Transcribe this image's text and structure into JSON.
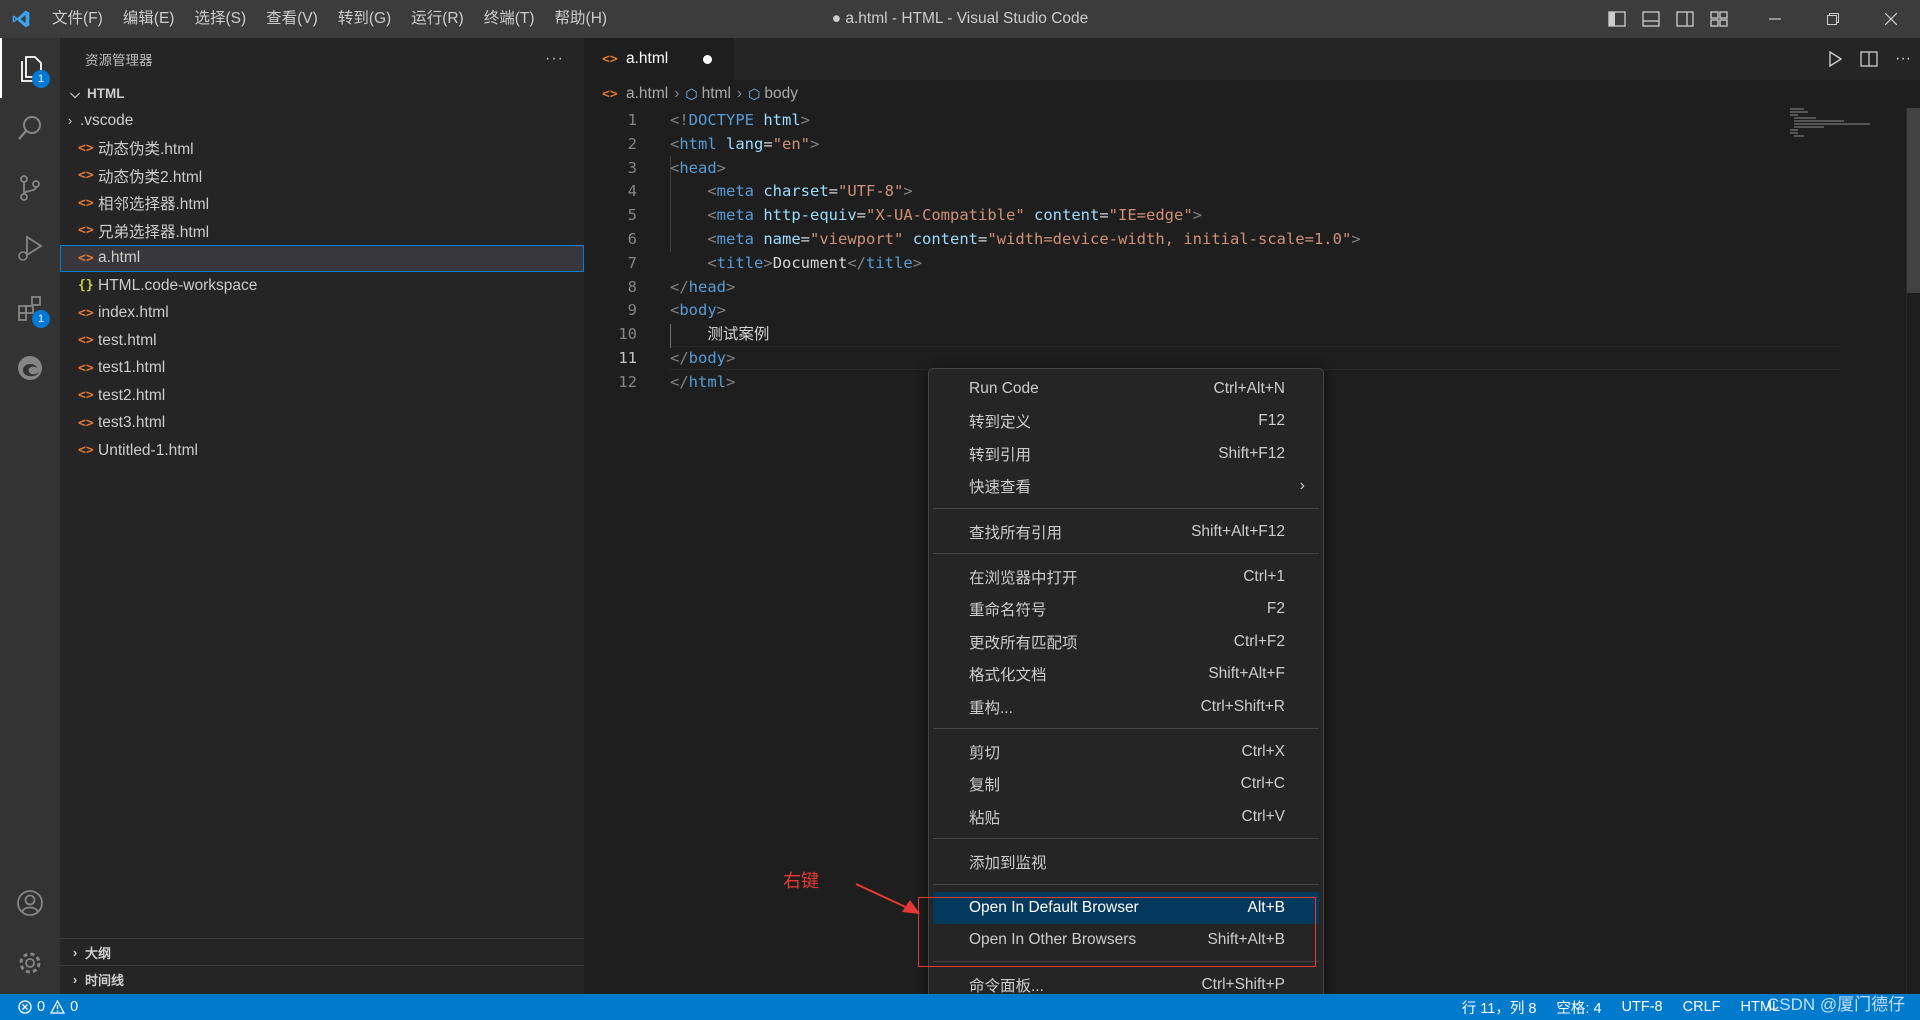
{
  "titlebar": {
    "menus": [
      "文件(F)",
      "编辑(E)",
      "选择(S)",
      "查看(V)",
      "转到(G)",
      "运行(R)",
      "终端(T)",
      "帮助(H)"
    ],
    "window_title": "● a.html - HTML - Visual Studio Code"
  },
  "activitybar": {
    "explorer_badge": "1",
    "extensions_badge": "1"
  },
  "sidebar": {
    "header": "资源管理器",
    "more": "···",
    "folder": "HTML",
    "items": [
      {
        "label": ".vscode",
        "kind": "folder"
      },
      {
        "label": "动态伪类.html",
        "kind": "html"
      },
      {
        "label": "动态伪类2.html",
        "kind": "html"
      },
      {
        "label": "相邻选择器.html",
        "kind": "html"
      },
      {
        "label": "兄弟选择器.html",
        "kind": "html"
      },
      {
        "label": "a.html",
        "kind": "html",
        "selected": true
      },
      {
        "label": "HTML.code-workspace",
        "kind": "json"
      },
      {
        "label": "index.html",
        "kind": "html"
      },
      {
        "label": "test.html",
        "kind": "html"
      },
      {
        "label": "test1.html",
        "kind": "html"
      },
      {
        "label": "test2.html",
        "kind": "html"
      },
      {
        "label": "test3.html",
        "kind": "html"
      },
      {
        "label": "Untitled-1.html",
        "kind": "html"
      }
    ],
    "outline": "大纲",
    "timeline": "时间线"
  },
  "tab": {
    "label": "a.html"
  },
  "breadcrumb": {
    "file": "a.html",
    "html": "html",
    "body": "body"
  },
  "editor": {
    "current_line": 11,
    "lines": [
      [
        {
          "t": "br",
          "v": "<!"
        },
        {
          "t": "tag",
          "v": "DOCTYPE"
        },
        {
          "t": "txt",
          "v": " "
        },
        {
          "t": "attr",
          "v": "html"
        },
        {
          "t": "br",
          "v": ">"
        }
      ],
      [
        {
          "t": "br",
          "v": "<"
        },
        {
          "t": "tag",
          "v": "html"
        },
        {
          "t": "txt",
          "v": " "
        },
        {
          "t": "attr",
          "v": "lang"
        },
        {
          "t": "txt",
          "v": "="
        },
        {
          "t": "str",
          "v": "\"en\""
        },
        {
          "t": "br",
          "v": ">"
        }
      ],
      [
        {
          "t": "br",
          "v": "<"
        },
        {
          "t": "tag",
          "v": "head"
        },
        {
          "t": "br",
          "v": ">"
        }
      ],
      [
        {
          "t": "txt",
          "v": "    "
        },
        {
          "t": "br",
          "v": "<"
        },
        {
          "t": "tag",
          "v": "meta"
        },
        {
          "t": "txt",
          "v": " "
        },
        {
          "t": "attr",
          "v": "charset"
        },
        {
          "t": "txt",
          "v": "="
        },
        {
          "t": "str",
          "v": "\"UTF-8\""
        },
        {
          "t": "br",
          "v": ">"
        }
      ],
      [
        {
          "t": "txt",
          "v": "    "
        },
        {
          "t": "br",
          "v": "<"
        },
        {
          "t": "tag",
          "v": "meta"
        },
        {
          "t": "txt",
          "v": " "
        },
        {
          "t": "attr",
          "v": "http-equiv"
        },
        {
          "t": "txt",
          "v": "="
        },
        {
          "t": "str",
          "v": "\"X-UA-Compatible\""
        },
        {
          "t": "txt",
          "v": " "
        },
        {
          "t": "attr",
          "v": "content"
        },
        {
          "t": "txt",
          "v": "="
        },
        {
          "t": "str",
          "v": "\"IE=edge\""
        },
        {
          "t": "br",
          "v": ">"
        }
      ],
      [
        {
          "t": "txt",
          "v": "    "
        },
        {
          "t": "br",
          "v": "<"
        },
        {
          "t": "tag",
          "v": "meta"
        },
        {
          "t": "txt",
          "v": " "
        },
        {
          "t": "attr",
          "v": "name"
        },
        {
          "t": "txt",
          "v": "="
        },
        {
          "t": "str",
          "v": "\"viewport\""
        },
        {
          "t": "txt",
          "v": " "
        },
        {
          "t": "attr",
          "v": "content"
        },
        {
          "t": "txt",
          "v": "="
        },
        {
          "t": "str",
          "v": "\"width=device-width, initial-scale=1.0\""
        },
        {
          "t": "br",
          "v": ">"
        }
      ],
      [
        {
          "t": "txt",
          "v": "    "
        },
        {
          "t": "br",
          "v": "<"
        },
        {
          "t": "tag",
          "v": "title"
        },
        {
          "t": "br",
          "v": ">"
        },
        {
          "t": "txt",
          "v": "Document"
        },
        {
          "t": "br",
          "v": "</"
        },
        {
          "t": "tag",
          "v": "title"
        },
        {
          "t": "br",
          "v": ">"
        }
      ],
      [
        {
          "t": "br",
          "v": "</"
        },
        {
          "t": "tag",
          "v": "head"
        },
        {
          "t": "br",
          "v": ">"
        }
      ],
      [
        {
          "t": "br",
          "v": "<"
        },
        {
          "t": "tag",
          "v": "body"
        },
        {
          "t": "br",
          "v": ">"
        }
      ],
      [
        {
          "t": "txt",
          "v": "    测试案例"
        }
      ],
      [
        {
          "t": "br",
          "v": "</"
        },
        {
          "t": "tag",
          "v": "body"
        },
        {
          "t": "br",
          "v": ">"
        }
      ],
      [
        {
          "t": "br",
          "v": "</"
        },
        {
          "t": "tag",
          "v": "html"
        },
        {
          "t": "br",
          "v": ">"
        }
      ]
    ]
  },
  "context_menu": {
    "groups": [
      [
        {
          "label": "Run Code",
          "key": "Ctrl+Alt+N"
        },
        {
          "label": "转到定义",
          "key": "F12"
        },
        {
          "label": "转到引用",
          "key": "Shift+F12"
        },
        {
          "label": "快速查看",
          "key": "",
          "submenu": true
        }
      ],
      [
        {
          "label": "查找所有引用",
          "key": "Shift+Alt+F12"
        }
      ],
      [
        {
          "label": "在浏览器中打开",
          "key": "Ctrl+1"
        },
        {
          "label": "重命名符号",
          "key": "F2"
        },
        {
          "label": "更改所有匹配项",
          "key": "Ctrl+F2"
        },
        {
          "label": "格式化文档",
          "key": "Shift+Alt+F"
        },
        {
          "label": "重构...",
          "key": "Ctrl+Shift+R"
        }
      ],
      [
        {
          "label": "剪切",
          "key": "Ctrl+X"
        },
        {
          "label": "复制",
          "key": "Ctrl+C"
        },
        {
          "label": "粘贴",
          "key": "Ctrl+V"
        }
      ],
      [
        {
          "label": "添加到监视",
          "key": ""
        }
      ],
      [
        {
          "label": "Open In Default Browser",
          "key": "Alt+B",
          "highlighted": true
        },
        {
          "label": "Open In Other Browsers",
          "key": "Shift+Alt+B"
        }
      ],
      [
        {
          "label": "命令面板...",
          "key": "Ctrl+Shift+P"
        }
      ]
    ]
  },
  "annotation": {
    "label": "右键"
  },
  "statusbar": {
    "errors": "0",
    "warnings": "0",
    "position": "行 11，列 8",
    "spaces": "空格: 4",
    "encoding": "UTF-8",
    "eol": "CRLF",
    "language": "HTML"
  },
  "watermark": "CSDN @厦门德仔",
  "colors": {
    "statusbar": "#007acc",
    "accent_badge": "#0078d4",
    "menu_highlight": "#04395e",
    "annotation": "#e53935"
  }
}
